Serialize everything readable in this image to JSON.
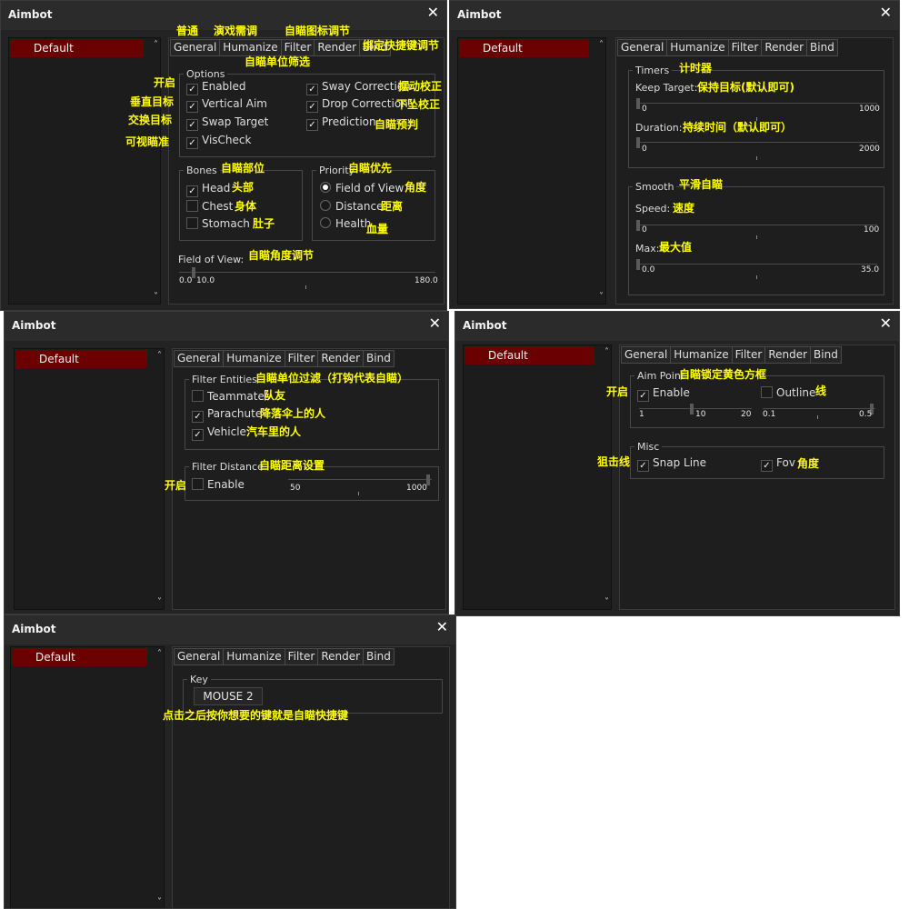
{
  "app": {
    "title": "Aimbot",
    "close": "✕",
    "profile": "Default",
    "tabs": [
      "General",
      "Humanize",
      "Filter",
      "Render",
      "Bind"
    ]
  },
  "icons": {
    "close": "close-icon",
    "check": "check-icon",
    "scroll_up": "chevron-up-icon",
    "scroll_down": "chevron-down-icon"
  },
  "colors": {
    "selection": "#6b0000",
    "annotation": "#ffff00",
    "panel": "#1e1e1e"
  },
  "glyphs": {
    "check": "✓",
    "up": "˄",
    "down": "˅"
  },
  "p1": {
    "ann_top": [
      "普通",
      "演戏需调",
      "自瞄图标调节",
      "绑定快捷键调节"
    ],
    "ann_filter": "自瞄单位筛选",
    "options_title": "Options",
    "options_left": [
      {
        "label": "Enabled",
        "checked": true,
        "ann_left": "开启"
      },
      {
        "label": "Vertical Aim",
        "checked": true,
        "ann_left": "垂直目标"
      },
      {
        "label": "Swap Target",
        "checked": true,
        "ann_left": "交换目标"
      },
      {
        "label": "VisCheck",
        "checked": true,
        "ann_left": "可视瞄准"
      }
    ],
    "options_right": [
      {
        "label": "Sway Correction",
        "checked": true,
        "ann": "摆动校正"
      },
      {
        "label": "Drop Correction",
        "checked": true,
        "ann": "下坠校正"
      },
      {
        "label": "Prediction",
        "checked": true,
        "ann": "自瞄预判"
      }
    ],
    "bones_title": "Bones",
    "bones_ann": "自瞄部位",
    "bones": [
      {
        "label": "Head",
        "checked": true,
        "ann": "头部"
      },
      {
        "label": "Chest",
        "checked": false,
        "ann": "身体"
      },
      {
        "label": "Stomach",
        "checked": false,
        "ann": "肚子"
      }
    ],
    "priority_title": "Priority",
    "priority_ann": "自瞄优先",
    "priority": [
      {
        "label": "Field of View",
        "selected": true,
        "ann": "角度"
      },
      {
        "label": "Distance",
        "selected": false,
        "ann": "距离"
      },
      {
        "label": "Health",
        "selected": false,
        "ann": "血量"
      }
    ],
    "fov_label": "Field of View:",
    "fov_ann": "自瞄角度调节",
    "fov_min": "0.0",
    "fov_value": "10.0",
    "fov_max": "180.0"
  },
  "p2": {
    "timers_title": "Timers",
    "timers_ann": "计时器",
    "keep_label": "Keep Target:",
    "keep_ann": "保持目标(默认即可)",
    "keep_min": "0",
    "keep_max": "1000",
    "duration_label": "Duration:",
    "duration_ann": "持续时间（默认即可）",
    "duration_min": "0",
    "duration_max": "2000",
    "smooth_title": "Smooth",
    "smooth_ann": "平滑自瞄",
    "speed_label": "Speed:",
    "speed_ann": "速度",
    "speed_min": "0",
    "speed_max": "100",
    "max_label": "Max:",
    "max_ann": "最大值",
    "max_min": "0.0",
    "max_max": "35.0"
  },
  "p3": {
    "entities_title": "Filter Entities",
    "entities_ann": "自瞄单位过滤（打钩代表自瞄）",
    "entities": [
      {
        "label": "Teammates",
        "checked": false,
        "ann": "队友"
      },
      {
        "label": "Parachute",
        "checked": true,
        "ann": "降落伞上的人"
      },
      {
        "label": "Vehicle",
        "checked": true,
        "ann": "汽车里的人"
      }
    ],
    "distance_title": "Filter Distance",
    "distance_ann": "自瞄距离设置",
    "enable_label": "Enable",
    "enable_checked": false,
    "enable_ann": "开启",
    "dist_min": "50",
    "dist_max": "1000"
  },
  "p4": {
    "aimpoint_title": "Aim Point",
    "aimpoint_ann": "自瞄锁定黄色方框",
    "enable_label": "Enable",
    "enable_checked": true,
    "enable_ann": "开启",
    "outline_label": "Outline",
    "outline_checked": false,
    "outline_ann": "线",
    "s1_min": "1",
    "s1_val": "10",
    "s1_max": "20",
    "s2_min": "0.1",
    "s2_max": "0.5",
    "misc_title": "Misc",
    "snap_label": "Snap Line",
    "snap_checked": true,
    "snap_ann": "狙击线",
    "fov_label": "Fov",
    "fov_checked": true,
    "fov_ann": "角度"
  },
  "p5": {
    "key_title": "Key",
    "key_value": "MOUSE 2",
    "key_ann": "点击之后按你想要的键就是自瞄快捷键"
  }
}
